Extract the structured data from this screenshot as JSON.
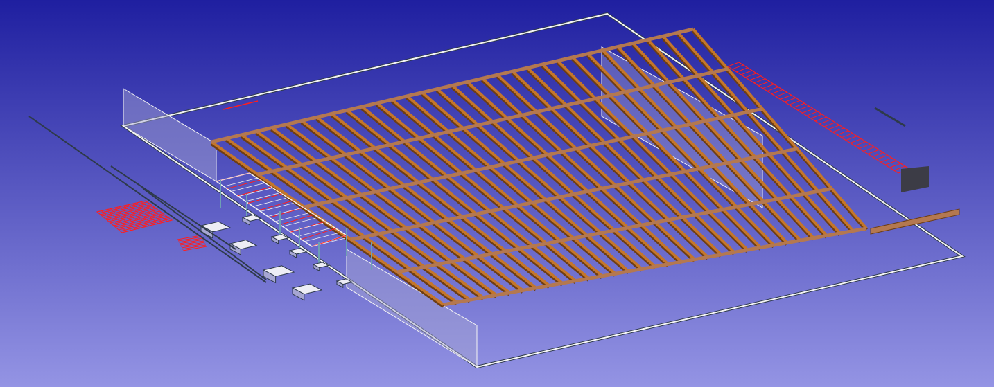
{
  "viewport": {
    "background_top": "#1f1fa0",
    "background_bottom": "#9494e4"
  },
  "colors": {
    "outline": "#f4f4f4",
    "outline_shadow": "#2e3a4a",
    "joist": "#c4762a",
    "joist_dark": "#6e3e14",
    "beam": "#b47850",
    "glass": "#a6a6d2",
    "rebar": "#ff1e1e",
    "footing": "#ededf5",
    "column": "#6ea0b4",
    "panel_dark": "#3c3c46"
  },
  "model": {
    "joist_count": 33,
    "beam_line_count": 5,
    "footing_count": 9
  }
}
